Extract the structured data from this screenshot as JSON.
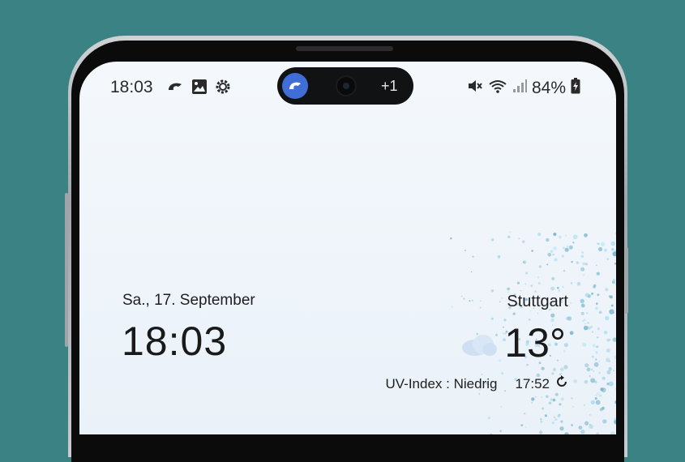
{
  "status_bar": {
    "time": "18:03",
    "left_icons": [
      "swirl-app-icon",
      "gallery-icon",
      "settings-gear-icon"
    ],
    "right_icons": [
      "mute-icon",
      "wifi-icon",
      "signal-icon"
    ],
    "battery_percent": "84%"
  },
  "camera_pill": {
    "app_icon": "swirl-app-icon",
    "more_count": "+1"
  },
  "lockscreen": {
    "date": "Sa., 17. September",
    "clock": "18:03"
  },
  "weather": {
    "city": "Stuttgart",
    "temperature": "13°",
    "condition_icon": "cloud-icon",
    "uv_index": "UV-Index : Niedrig",
    "updated_time": "17:52",
    "refresh_icon": "refresh-icon"
  },
  "colors": {
    "background": "#3a8284",
    "pill_app_blue": "#3f6fd6"
  }
}
